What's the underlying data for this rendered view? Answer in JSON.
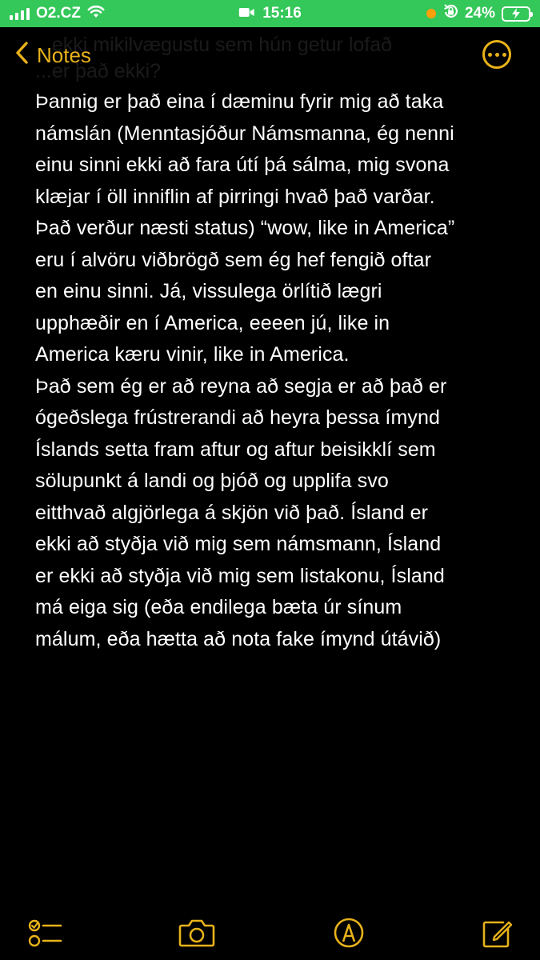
{
  "status_bar": {
    "carrier": "O2.CZ",
    "time": "15:16",
    "battery_percent": "24%",
    "signal_bars": 4
  },
  "header": {
    "back_label": "Notes",
    "ghost_text": "...ekki mikilvægustu sem hún getur lofað\n...er það ekki?"
  },
  "note": {
    "lines": [
      "Þannig er það eina í dæminu fyrir mig að taka",
      "námslán (Menntasjóður Námsmanna, ég nenni",
      "einu sinni ekki að fara útí þá sálma, mig svona",
      "klæjar í öll inniflin af pirringi hvað það varðar.",
      "Það verður næsti status) “wow, like in America”",
      "eru í alvöru viðbrögð sem ég hef fengið oftar",
      "en einu sinni. Já, vissulega örlítið lægri",
      "upphæðir en í America, eeeen jú, like in",
      "America kæru vinir, like in America.",
      "Það sem ég er að reyna að segja er að það er",
      "ógeðslega frústrerandi að heyra þessa ímynd",
      "Íslands setta fram aftur og aftur beisikklí sem",
      "sölupunkt á landi og þjóð og upplifa svo",
      "eitthvað algjörlega á skjön við það. Ísland er",
      "ekki að styðja við mig sem námsmann, Ísland",
      "er ekki að styðja við mig sem listakonu, Ísland",
      "má eiga sig (eða endilega bæta úr sínum",
      "málum, eða hætta að nota fake ímynd útávið)"
    ]
  },
  "toolbar": {
    "icons": [
      "checklist-icon",
      "camera-icon",
      "markup-icon",
      "compose-icon"
    ]
  },
  "colors": {
    "accent": "#e8b21a",
    "status_bar": "#34c759",
    "background": "#000000",
    "text": "#ffffff"
  }
}
